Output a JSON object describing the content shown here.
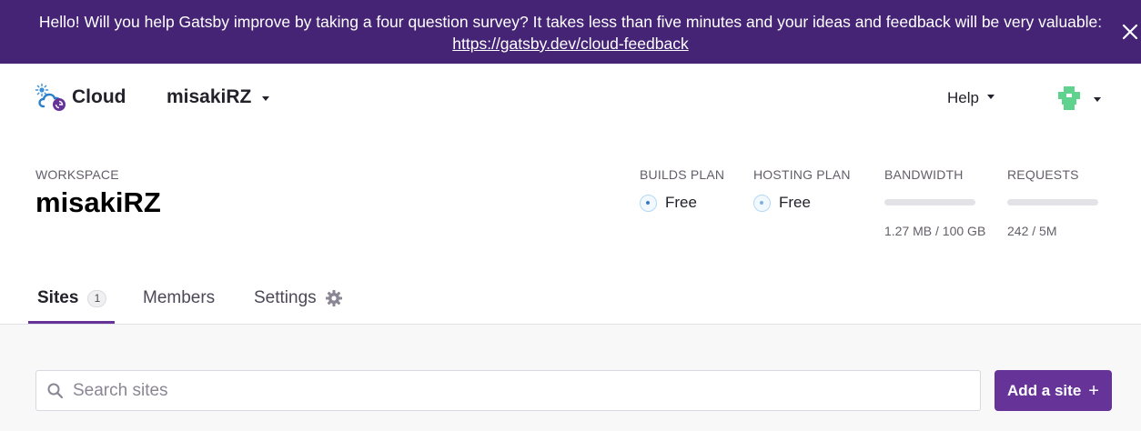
{
  "banner": {
    "message": "Hello! Will you help Gatsby improve by taking a four question survey? It takes less than five minutes and your ideas and feedback will be very valuable:",
    "link_text": "https://gatsby.dev/cloud-feedback",
    "close_icon": "close-icon"
  },
  "header": {
    "logo_text": "Cloud",
    "workspace_switcher": "misakiRZ",
    "help_label": "Help",
    "avatar_icon": "identicon-avatar"
  },
  "workspace": {
    "label": "WORKSPACE",
    "name": "misakiRZ",
    "builds_plan": {
      "label": "BUILDS PLAN",
      "value": "Free"
    },
    "hosting_plan": {
      "label": "HOSTING PLAN",
      "value": "Free"
    },
    "bandwidth": {
      "label": "BANDWIDTH",
      "value": "1.27 MB / 100 GB",
      "fraction_used": 0.0
    },
    "requests": {
      "label": "REQUESTS",
      "value": "242 / 5M",
      "fraction_used": 0.0
    }
  },
  "tabs": [
    {
      "label": "Sites",
      "count": "1",
      "active": true
    },
    {
      "label": "Members",
      "active": false
    },
    {
      "label": "Settings",
      "icon": "gear-icon",
      "active": false
    }
  ],
  "content": {
    "search_placeholder": "Search sites",
    "search_value": "",
    "add_site_label": "Add a site",
    "add_site_icon": "plus-icon"
  },
  "colors": {
    "banner_bg": "#452475",
    "brand_purple": "#663399",
    "content_bg": "#f8f8f8",
    "avatar_green": "#5fd38d"
  }
}
